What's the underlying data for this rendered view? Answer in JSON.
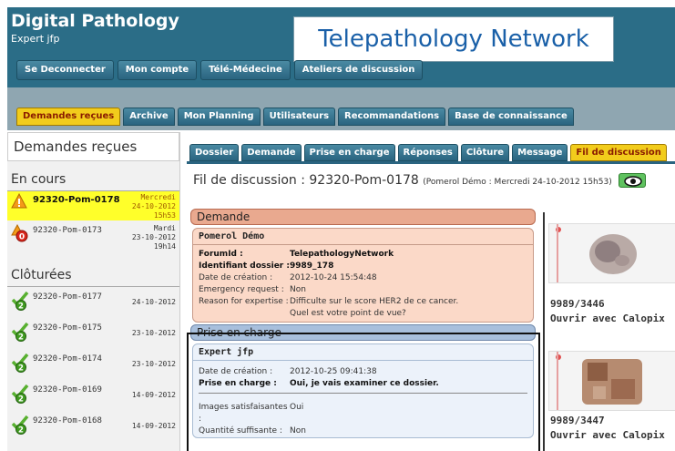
{
  "header": {
    "app_title": "Digital Pathology",
    "user_line": "Expert jfp",
    "banner": "Telepathology Network"
  },
  "top_nav": [
    "Se Deconnecter",
    "Mon compte",
    "Télé-Médecine",
    "Ateliers de discussion"
  ],
  "sub_nav": {
    "items": [
      "Demandes reçues",
      "Archive",
      "Mon Planning",
      "Utilisateurs",
      "Recommandations",
      "Base de connaissance"
    ],
    "active": "Demandes reçues"
  },
  "left_panel": {
    "title": "Demandes reçues",
    "in_progress_title": "En cours",
    "in_progress": [
      {
        "id": "92320-Pom-0178",
        "day": "Mercredi",
        "date": "24-10-2012",
        "time": "15h53",
        "status": "warning-icon"
      },
      {
        "id": "92320-Pom-0173",
        "day": "Mardi",
        "date": "23-10-2012",
        "time": "19h14",
        "status": "alert-zero-icon",
        "badge": "0"
      }
    ],
    "closed_title": "Clôturées",
    "closed": [
      {
        "id": "92320-Pom-0177",
        "date": "24-10-2012",
        "badge": "2"
      },
      {
        "id": "92320-Pom-0175",
        "date": "23-10-2012",
        "badge": "2"
      },
      {
        "id": "92320-Pom-0174",
        "date": "23-10-2012",
        "badge": "2"
      },
      {
        "id": "92320-Pom-0169",
        "date": "14-09-2012",
        "badge": "2"
      },
      {
        "id": "92320-Pom-0168",
        "date": "14-09-2012",
        "badge": "2"
      }
    ]
  },
  "tabs": {
    "items": [
      "Dossier",
      "Demande",
      "Prise en charge",
      "Réponses",
      "Clôture",
      "Message",
      "Fil de discussion"
    ],
    "active": "Fil de discussion"
  },
  "thread": {
    "title": "Fil de discussion : 92320-Pom-0178",
    "meta": "(Pomerol Démo : Mercredi 24-10-2012  15h53)",
    "demande": {
      "heading": "Demande",
      "author": "Pomerol Démo",
      "rows": [
        {
          "label": "ForumId :",
          "value": "TelepathologyNetwork",
          "bold": true
        },
        {
          "label": "Identifiant dossier :",
          "value": "9989_178",
          "bold": true
        },
        {
          "label": "Date de création :",
          "value": "2012-10-24 15:54:48",
          "bold": false
        },
        {
          "label": "Emergency request :",
          "value": "Non",
          "bold": false
        },
        {
          "label": "Reason for expertise :",
          "value": "Difficulte sur le score HER2 de ce cancer.",
          "bold": false
        },
        {
          "label": "",
          "value": "Quel est votre point de vue?",
          "bold": false
        }
      ]
    },
    "prise": {
      "heading": "Prise en charge",
      "author": "Expert jfp",
      "rows": [
        {
          "label": "Date de création :",
          "value": "2012-10-25 09:41:38",
          "bold": false
        },
        {
          "label": "Prise en charge :",
          "value": "Oui, je vais examiner ce dossier.",
          "bold": true
        }
      ],
      "rows2": [
        {
          "label": "Images satisfaisantes :",
          "value": "Oui",
          "bold": false
        },
        {
          "label": "Quantité suffisante :",
          "value": "Non",
          "bold": false
        }
      ]
    }
  },
  "slides": [
    {
      "number": "9989/3446",
      "action": "Ouvrir avec Calopix"
    },
    {
      "number": "9989/3447",
      "action": "Ouvrir avec Calopix"
    }
  ],
  "colors": {
    "header_bg": "#2b6d87",
    "active_tab": "#f2cc1c",
    "demande_head": "#e9a98f",
    "prise_head": "#a8bfdc",
    "selected_row": "#ffff2a"
  }
}
